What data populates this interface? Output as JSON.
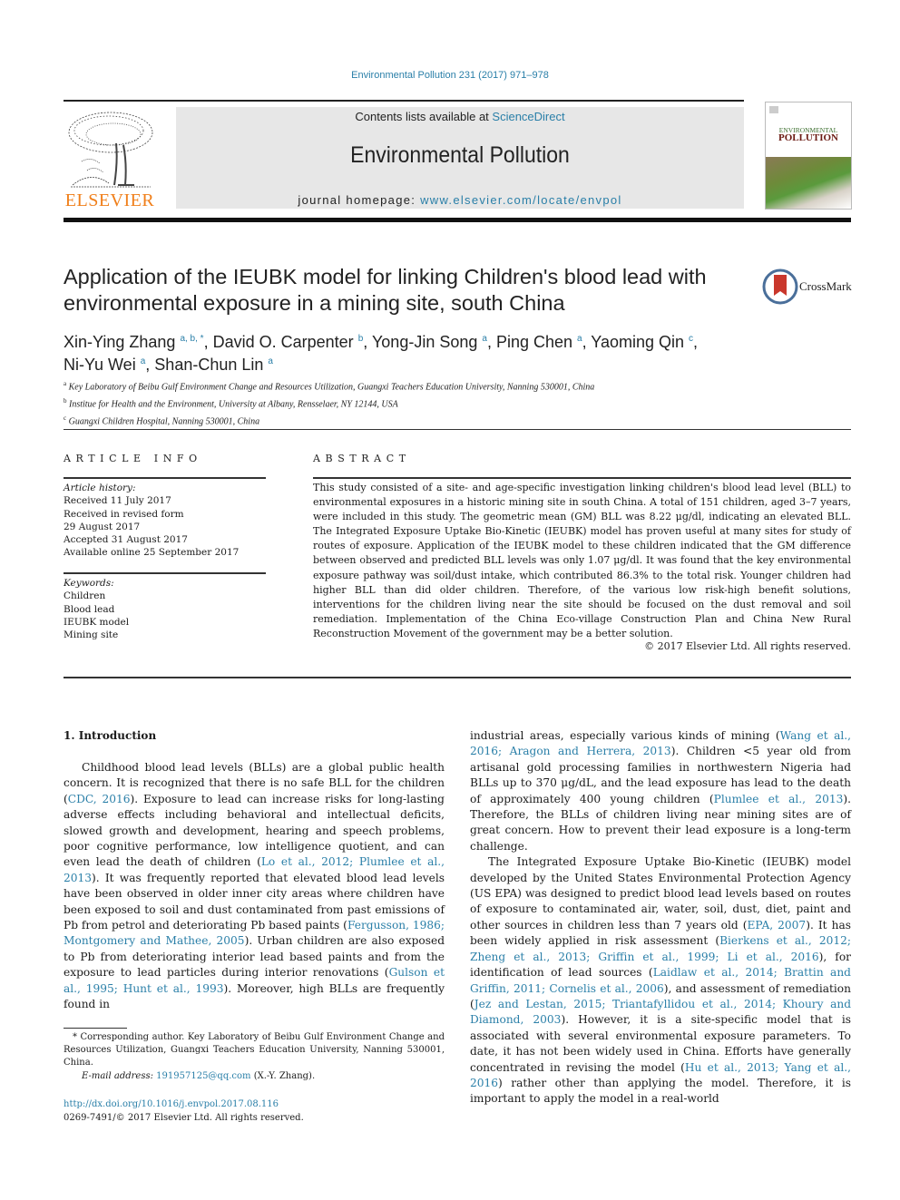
{
  "header": {
    "citation": "Environmental Pollution 231 (2017) 971–978",
    "contents_prefix": "Contents lists available at ",
    "contents_link": "ScienceDirect",
    "journal_title": "Environmental Pollution",
    "homepage_prefix": "journal homepage: ",
    "homepage_link": "www.elsevier.com/locate/envpol",
    "publisher_logo_text": "ELSEVIER",
    "cover": {
      "line1": "ENVIRONMENTAL",
      "line2": "POLLUTION"
    },
    "brand_orange": "#f07f1a",
    "link_color": "#2a7fa8"
  },
  "article": {
    "title": "Application of the IEUBK model for linking Children's blood lead with environmental exposure in a mining site, south China",
    "crossmark_label": "CrossMark",
    "authors": [
      {
        "name": "Xin-Ying Zhang",
        "sup": "a, b, *"
      },
      {
        "name": "David O. Carpenter",
        "sup": "b"
      },
      {
        "name": "Yong-Jin Song",
        "sup": "a"
      },
      {
        "name": "Ping Chen",
        "sup": "a"
      },
      {
        "name": "Yaoming Qin",
        "sup": "c"
      },
      {
        "name": "Ni-Yu Wei",
        "sup": "a"
      },
      {
        "name": "Shan-Chun Lin",
        "sup": "a"
      }
    ],
    "affiliations": [
      {
        "key": "a",
        "text": "Key Laboratory of Beibu Gulf Environment Change and Resources Utilization, Guangxi Teachers Education University, Nanning 530001, China"
      },
      {
        "key": "b",
        "text": "Institue for Health and the Environment, University at Albany, Rensselaer, NY 12144, USA"
      },
      {
        "key": "c",
        "text": "Guangxi Children Hospital, Nanning 530001, China"
      }
    ]
  },
  "article_info": {
    "heading": "ARTICLE INFO",
    "history_label": "Article history:",
    "history": [
      "Received 11 July 2017",
      "Received in revised form",
      "29 August 2017",
      "Accepted 31 August 2017",
      "Available online 25 September 2017"
    ],
    "keywords_label": "Keywords:",
    "keywords": [
      "Children",
      "Blood lead",
      "IEUBK model",
      "Mining site"
    ]
  },
  "abstract": {
    "heading": "ABSTRACT",
    "text": "This study consisted of a site- and age-specific investigation linking children's blood lead level (BLL) to environmental exposures in a historic mining site in south China. A total of 151 children, aged 3–7 years, were included in this study. The geometric mean (GM) BLL was 8.22 μg/dl, indicating an elevated BLL. The Integrated Exposure Uptake Bio-Kinetic (IEUBK) model has proven useful at many sites for study of routes of exposure. Application of the IEUBK model to these children indicated that the GM difference between observed and predicted BLL levels was only 1.07 μg/dl. It was found that the key environmental exposure pathway was soil/dust intake, which contributed 86.3% to the total risk. Younger children had higher BLL than did older children. Therefore, of the various low risk-high benefit solutions, interventions for the children living near the site should be focused on the dust removal and soil remediation. Implementation of the China Eco-village Construction Plan and China New Rural Reconstruction Movement of the government may be a better solution.",
    "copyright": "© 2017 Elsevier Ltd. All rights reserved."
  },
  "intro": {
    "heading": "1.  Introduction",
    "left": [
      {
        "t": "Childhood blood lead levels (BLLs) are a global public health concern. It is recognized that there is no safe BLL for the children ("
      },
      {
        "l": "CDC, 2016"
      },
      {
        "t": "). Exposure to lead can increase risks for long-lasting adverse effects including behavioral and intellectual deficits, slowed growth and development, hearing and speech problems, poor cognitive performance, low intelligence quotient, and can even lead the death of children ("
      },
      {
        "l": "Lo et al., 2012; Plumlee et al., 2013"
      },
      {
        "t": "). It was frequently reported that elevated blood lead levels have been observed in older inner city areas where children have been exposed to soil and dust contaminated from past emissions of Pb from petrol and deteriorating Pb based paints ("
      },
      {
        "l": "Fergusson, 1986; Montgomery and Mathee, 2005"
      },
      {
        "t": "). Urban children are also exposed to Pb from deteriorating interior lead based paints and from the exposure to lead particles during interior renovations ("
      },
      {
        "l": "Gulson et al., 1995; Hunt et al., 1993"
      },
      {
        "t": "). Moreover, high BLLs are frequently found in"
      }
    ],
    "right_p1": [
      {
        "t": "industrial areas, especially various kinds of mining ("
      },
      {
        "l": "Wang et al., 2016; Aragon and Herrera, 2013"
      },
      {
        "t": "). Children <5 year old from artisanal gold processing families in northwestern Nigeria had BLLs up to 370 μg/dL, and the lead exposure has lead to the death of approximately 400 young children ("
      },
      {
        "l": "Plumlee et al., 2013"
      },
      {
        "t": "). Therefore, the BLLs of children living near mining sites are of great concern. How to prevent their lead exposure is a long-term challenge."
      }
    ],
    "right_p2": [
      {
        "t": "The Integrated Exposure Uptake Bio-Kinetic (IEUBK) model developed by the United States Environmental Protection Agency (US EPA) was designed to predict blood lead levels based on routes of exposure to contaminated air, water, soil, dust, diet, paint and other sources in children less than 7 years old ("
      },
      {
        "l": "EPA, 2007"
      },
      {
        "t": "). It has been widely applied in risk assessment ("
      },
      {
        "l": "Bierkens et al., 2012; Zheng et al., 2013; Griffin et al., 1999; Li et al., 2016"
      },
      {
        "t": "), for identification of lead sources ("
      },
      {
        "l": "Laidlaw et al., 2014; Brattin and Griffin, 2011; Cornelis et al., 2006"
      },
      {
        "t": "), and assessment of remediation ("
      },
      {
        "l": "Jez and Lestan, 2015; Triantafyllidou et al., 2014; Khoury and Diamond, 2003"
      },
      {
        "t": "). However, it is a site-specific model that is associated with several environmental exposure parameters. To date, it has not been widely used in China. Efforts have generally concentrated in revising the model ("
      },
      {
        "l": "Hu et al., 2013; Yang et al., 2016"
      },
      {
        "t": ") rather other than applying the model. Therefore, it is important to apply the model in a real-world"
      }
    ]
  },
  "footnote": {
    "corresponding": "* Corresponding author. Key Laboratory of Beibu Gulf Environment Change and Resources Utilization, Guangxi Teachers Education University, Nanning 530001, China.",
    "email_label": "E-mail address: ",
    "email": "191957125@qq.com",
    "email_suffix": " (X.-Y. Zhang).",
    "doi": "http://dx.doi.org/10.1016/j.envpol.2017.08.116",
    "issn_copyright": "0269-7491/© 2017 Elsevier Ltd. All rights reserved."
  }
}
